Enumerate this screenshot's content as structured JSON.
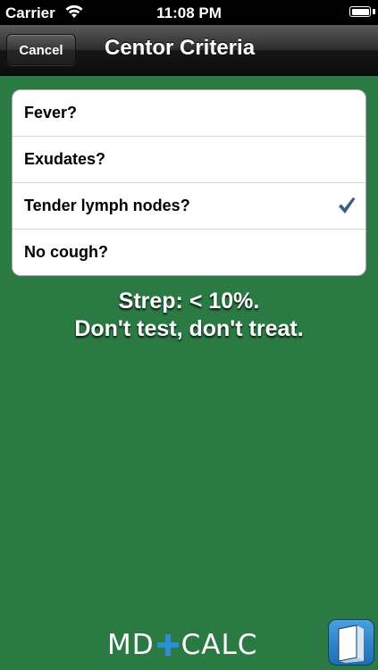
{
  "status_bar": {
    "carrier": "Carrier",
    "time": "11:08 PM"
  },
  "nav": {
    "cancel_label": "Cancel",
    "title": "Centor Criteria"
  },
  "criteria": [
    {
      "label": "Fever?",
      "checked": false
    },
    {
      "label": "Exudates?",
      "checked": false
    },
    {
      "label": "Tender lymph nodes?",
      "checked": true
    },
    {
      "label": "No cough?",
      "checked": false
    }
  ],
  "result": {
    "line1": "Strep: < 10%.",
    "line2": "Don't test, don't treat."
  },
  "footer": {
    "logo_left": "MD",
    "logo_right": "CALC"
  },
  "colors": {
    "background": "#2b7a44",
    "checkmark": "#3a5a8c",
    "logo_plus": "#2a8fd6",
    "book_button": "#1d6fb2"
  },
  "icons": {
    "wifi": "wifi-icon",
    "battery": "battery-icon",
    "checkmark": "checkmark-icon",
    "book": "book-icon"
  }
}
